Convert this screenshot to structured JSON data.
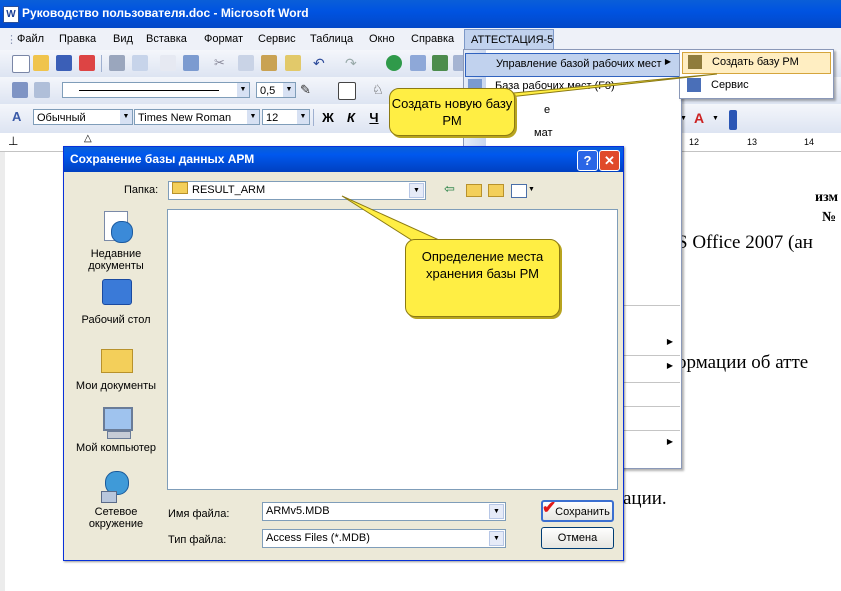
{
  "window": {
    "title": "Руководство пользователя.doc - Microsoft Word",
    "app_icon": "W"
  },
  "menubar": {
    "items": [
      "Файл",
      "Правка",
      "Вид",
      "Вставка",
      "Формат",
      "Сервис",
      "Таблица",
      "Окно",
      "Справка"
    ],
    "active": "АТТЕСТАЦИЯ-5"
  },
  "toolbar": {
    "zoom": "0,5",
    "style": "Обычный",
    "font": "Times New Roman",
    "size": "12",
    "bold": "Ж",
    "italic": "К",
    "underline": "Ч"
  },
  "ruler": {
    "marks": [
      "12",
      "13",
      "14"
    ]
  },
  "document": {
    "heading": "изм",
    "number": "№",
    "line1": "S Office 2007 (ан",
    "line2": "ормации об атте",
    "line3": "ации."
  },
  "dropdown": {
    "manage": "Управление базой рабочих мест",
    "db": "База рабочих мест (F8)",
    "partial1": "е",
    "partial2": "мат"
  },
  "submenu": {
    "create": "Создать базу РМ",
    "service": "Сервис"
  },
  "callouts": {
    "create": "Создать новую базу РМ",
    "location": "Определение места хранения базы РМ"
  },
  "dialog": {
    "title": "Сохранение базы данных АРМ",
    "folder_label": "Папка:",
    "folder_value": "RESULT_ARM",
    "places": [
      "Недавние документы",
      "Рабочий стол",
      "Мои документы",
      "Мой компьютер",
      "Сетевое окружение"
    ],
    "filename_label": "Имя файла:",
    "filename_value": "ARMv5.MDB",
    "filetype_label": "Тип файла:",
    "filetype_value": "Access Files (*.MDB)",
    "save": "Сохранить",
    "cancel": "Отмена"
  },
  "colors": {
    "titlebar": "#0053e1",
    "callout": "#ffee44",
    "dialog_bg": "#ece9d8",
    "highlight": "#c1d2ee"
  }
}
